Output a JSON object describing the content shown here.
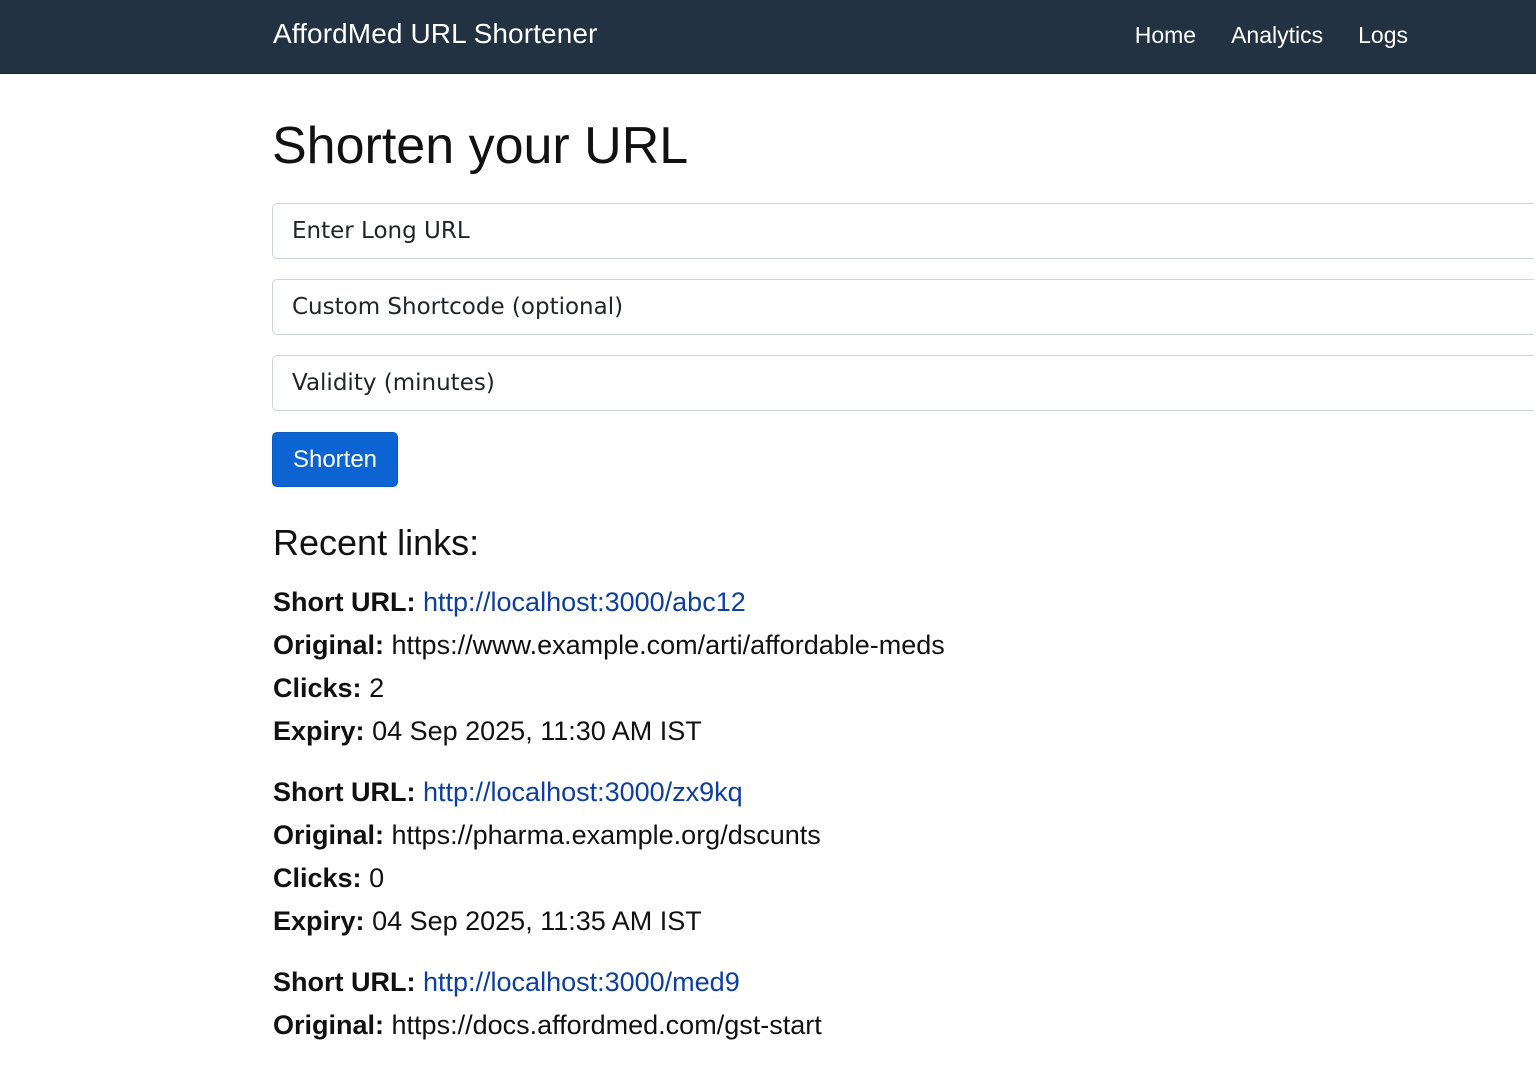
{
  "navbar": {
    "brand": "AffordMed URL Shortener",
    "links": [
      "Home",
      "Analytics",
      "Logs"
    ]
  },
  "form": {
    "title": "Shorten your URL",
    "long_url_placeholder": "Enter Long URL",
    "shortcode_placeholder": "Custom Shortcode (optional)",
    "validity_placeholder": "Validity (minutes)",
    "submit_label": "Shorten"
  },
  "recent": {
    "title": "Recent links:",
    "labels": {
      "short_url": "Short URL:",
      "original": "Original:",
      "clicks": "Clicks:",
      "expiry": "Expiry:"
    },
    "items": [
      {
        "short_url": "http://localhost:3000/abc12",
        "original": "https://www.example.com/arti/affordable-meds",
        "clicks": "2",
        "expiry": "04 Sep 2025, 11:30 AM IST"
      },
      {
        "short_url": "http://localhost:3000/zx9kq",
        "original": "https://pharma.example.org/dscunts",
        "clicks": "0",
        "expiry": "04 Sep 2025, 11:35 AM IST"
      },
      {
        "short_url": "http://localhost:3000/med9",
        "original": "https://docs.affordmed.com/gst-start"
      }
    ]
  },
  "colors": {
    "navbar_bg": "#233242",
    "primary_button": "#0b64d2",
    "link": "#0d3fa0"
  }
}
